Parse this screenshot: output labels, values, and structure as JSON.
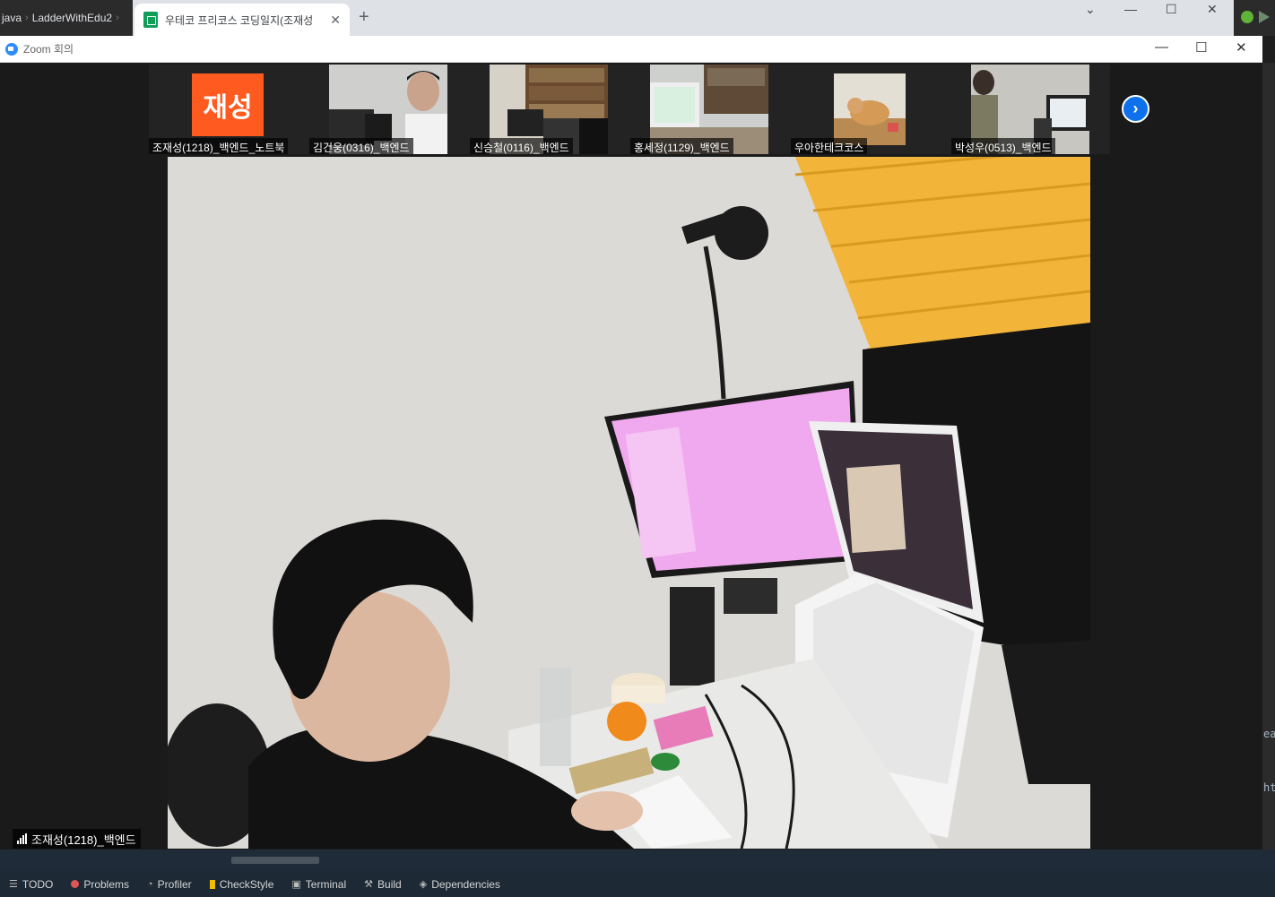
{
  "ide": {
    "breadcrumbs": [
      "java",
      "LadderWithEdu2"
    ],
    "right_fragments": [
      "ea",
      "ht"
    ],
    "tool_windows": [
      {
        "icon": "list-icon",
        "label": "TODO"
      },
      {
        "icon": "error-icon",
        "label": "Problems"
      },
      {
        "icon": "profiler-icon",
        "label": "Profiler"
      },
      {
        "icon": "checkstyle-icon",
        "label": "CheckStyle"
      },
      {
        "icon": "terminal-icon",
        "label": "Terminal"
      },
      {
        "icon": "hammer-icon",
        "label": "Build"
      },
      {
        "icon": "layers-icon",
        "label": "Dependencies"
      }
    ]
  },
  "browser": {
    "tab_title": "우테코 프리코스 코딩일지(조재성",
    "close_glyph": "✕",
    "new_tab_glyph": "+",
    "controls": [
      "⌄",
      "—",
      "☐",
      "✕"
    ]
  },
  "zoom": {
    "window_title": "Zoom 회의",
    "controls": [
      "—",
      "☐",
      "✕"
    ],
    "participants": [
      {
        "name": "조재성(1218)_백엔드_노트북",
        "avatar_text": "재성",
        "video": false
      },
      {
        "name": "김건웅(0316)_백엔드",
        "video": true,
        "scene": "person"
      },
      {
        "name": "신승철(0116)_백엔드",
        "video": true,
        "scene": "bookshelf"
      },
      {
        "name": "홍세정(1129)_백엔드",
        "video": true,
        "scene": "desk"
      },
      {
        "name": "우아한테크코스",
        "video": true,
        "scene": "cat"
      },
      {
        "name": "박성우(0513)_백엔드",
        "video": true,
        "scene": "room"
      }
    ],
    "next_glyph": "›",
    "active_speaker": "조재성(1218)_백엔드"
  }
}
